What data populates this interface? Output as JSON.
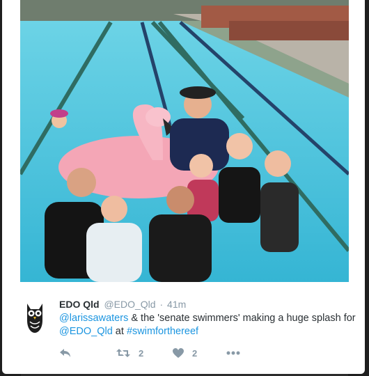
{
  "tweet": {
    "display_name": "EDO Qld",
    "handle": "@EDO_Qld",
    "separator": "·",
    "timestamp": "41m",
    "text_parts": {
      "mention1": "@larissawaters",
      "text1": " & the 'senate swimmers' making a huge splash for ",
      "mention2": "@EDO_Qld",
      "text2": " at ",
      "hashtag": "#swimforthereef"
    },
    "retweet_count": "2",
    "like_count": "2"
  },
  "icons": {
    "avatar": "owl-logo-icon",
    "reply": "reply-arrow-icon",
    "retweet": "retweet-icon",
    "like": "heart-icon",
    "more": "more-dots-icon"
  },
  "colors": {
    "link": "#1b95e0",
    "name": "#292f33",
    "muted": "#8899a6",
    "pool": "#4fc6dd"
  }
}
